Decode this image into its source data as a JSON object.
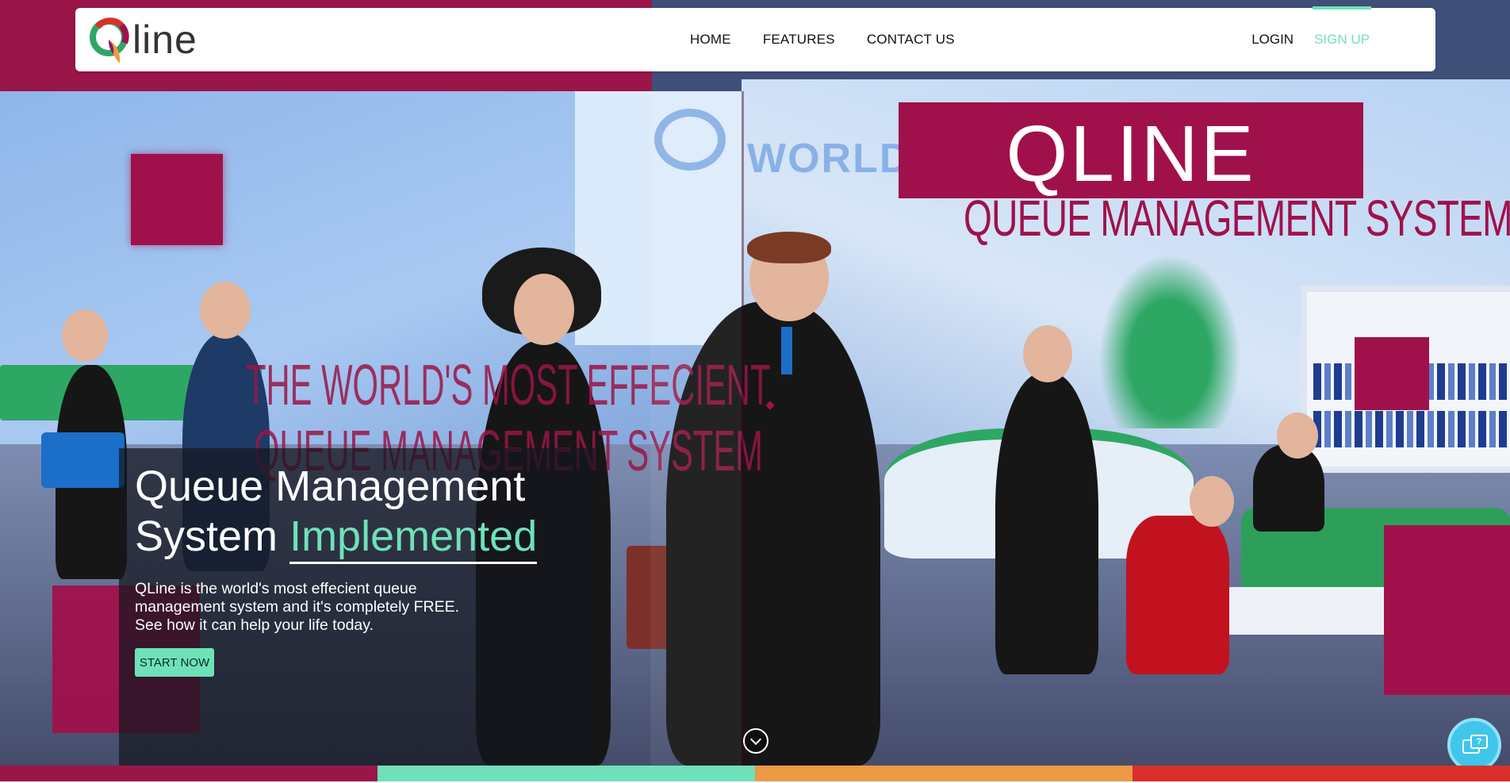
{
  "brand": {
    "name": "line",
    "logo": "qline-logo-mark"
  },
  "nav": {
    "links": [
      "HOME",
      "FEATURES",
      "CONTACT US"
    ],
    "login": "LOGIN",
    "signup": "SIGN UP"
  },
  "hero": {
    "banner_title": "QLINE",
    "banner_subtitle": "QUEUE MANAGEMENT SYSTEM",
    "world_text": "WORLD",
    "slogan_line1": "THE WORLD'S MOST EFFECIENT",
    "slogan_line2": "QUEUE MANAGEMENT SYSTEM",
    "title_part1": "Queue Management",
    "title_part2": "System",
    "title_accent": "Implemented",
    "description": "QLine is the world's most effecient queue management system and it's completely FREE. See how it can help your life today.",
    "cta": "START NOW"
  },
  "icons": {
    "scroll": "chevron-down-circle-icon",
    "chat": "chat-help-icon"
  },
  "colors": {
    "brand_magenta": "#a0114b",
    "accent_mint": "#6fe1b8",
    "chat_blue": "#3fc6ea",
    "stripe": [
      "#9a1548",
      "#6fe1b8",
      "#ec9a45",
      "#d9302c"
    ]
  }
}
